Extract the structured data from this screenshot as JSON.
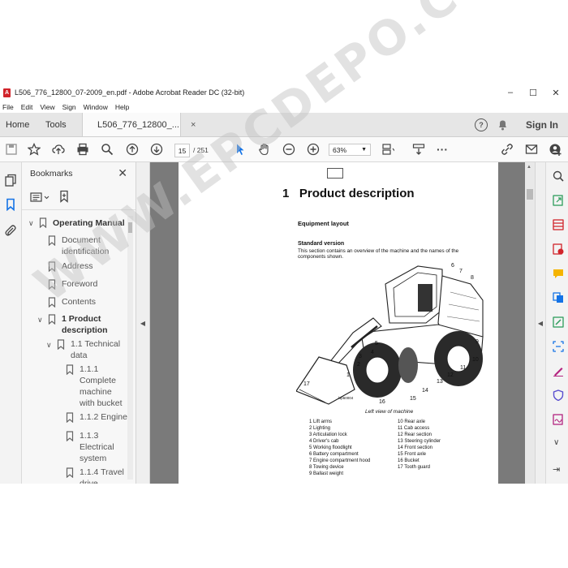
{
  "window": {
    "title": "L506_776_12800_07-2009_en.pdf - Adobe Acrobat Reader DC (32-bit)",
    "controls": {
      "minimize": "–",
      "maximize": "☐",
      "close": "✕"
    }
  },
  "menu": [
    "File",
    "Edit",
    "View",
    "Sign",
    "Window",
    "Help"
  ],
  "tabs": {
    "home": "Home",
    "tools": "Tools",
    "document": "L506_776_12800_...",
    "close": "×"
  },
  "header": {
    "sign_in": "Sign In",
    "help_icon": "?"
  },
  "toolbar": {
    "current_page": "15",
    "total_pages": "/ 251",
    "zoom": "63%",
    "more": "···"
  },
  "bookmarks": {
    "title": "Bookmarks",
    "items": [
      {
        "label": "Operating Manual",
        "level": 0,
        "bold": true,
        "expanded": true
      },
      {
        "label": "Document identification",
        "level": 1
      },
      {
        "label": "Address",
        "level": 1
      },
      {
        "label": "Foreword",
        "level": 1
      },
      {
        "label": "Contents",
        "level": 1
      },
      {
        "label": "1 Product description",
        "level": 1,
        "bold": true,
        "expanded": true
      },
      {
        "label": "1.1 Technical data",
        "level": 2,
        "expanded": true
      },
      {
        "label": "1.1.1 Complete machine with bucket",
        "level": 3
      },
      {
        "label": "1.1.2 Engine",
        "level": 3
      },
      {
        "label": "1.1.3 Electrical system",
        "level": 3
      },
      {
        "label": "1.1.4 Travel drive",
        "level": 3
      }
    ]
  },
  "document_page": {
    "chapter_number": "1",
    "chapter_title": "Product description",
    "section": "Equipment layout",
    "subsection": "Standard version",
    "intro_line1": "This section contains an overview of the machine and the names of the",
    "intro_line2": "components shown.",
    "figure_caption": "Left view of machine",
    "figure_code": "lsp60004",
    "callouts": [
      "1",
      "2",
      "3",
      "4",
      "5",
      "6",
      "7",
      "8",
      "9",
      "10",
      "11",
      "12",
      "13",
      "14",
      "15",
      "16",
      "17"
    ],
    "legend_left": [
      "1 Lift arms",
      "2 Lighting",
      "3 Articulation lock",
      "4 Driver's cab",
      "5 Working floodlight",
      "6 Battery compartment",
      "7 Engine compartment hood",
      "8 Towing device",
      "9 Ballast weight"
    ],
    "legend_right": [
      "10 Rear axle",
      "11 Cab access",
      "12 Rear section",
      "13 Steering cylinder",
      "14 Front section",
      "15 Front axle",
      "16 Bucket",
      "17 Tooth guard"
    ]
  },
  "watermark": "WWW.EPCDEPO.COM",
  "colors": {
    "accent": "#1473e6",
    "acrobat_red": "#d1232a",
    "page_bg": "#7a7a7a"
  }
}
